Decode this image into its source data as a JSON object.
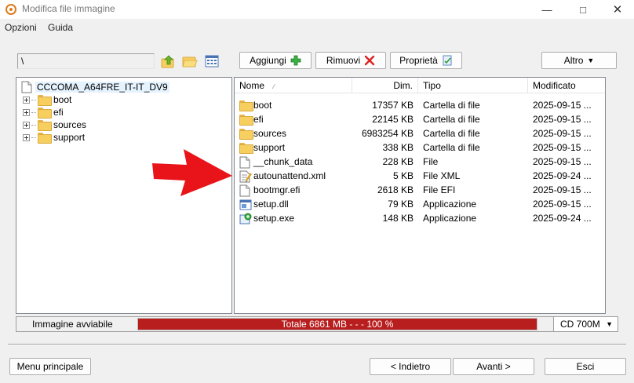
{
  "window": {
    "title": "Modifica file immagine"
  },
  "menu": {
    "items": [
      "Opzioni",
      "Guida"
    ]
  },
  "toolbar": {
    "path": "\\",
    "add_label": "Aggiungi",
    "remove_label": "Rimuovi",
    "properties_label": "Proprietà",
    "more_label": "Altro"
  },
  "tree": {
    "root": "CCCOMA_A64FRE_IT-IT_DV9",
    "items": [
      "boot",
      "efi",
      "sources",
      "support"
    ]
  },
  "list": {
    "columns": {
      "name": "Nome",
      "size": "Dim.",
      "type": "Tipo",
      "modified": "Modificato"
    },
    "rows": [
      {
        "name": "boot",
        "size": "17357 KB",
        "type": "Cartella di file",
        "modified": "2025-09-15 ...",
        "icon": "folder-icon"
      },
      {
        "name": "efi",
        "size": "22145 KB",
        "type": "Cartella di file",
        "modified": "2025-09-15 ...",
        "icon": "folder-icon"
      },
      {
        "name": "sources",
        "size": "6983254 KB",
        "type": "Cartella di file",
        "modified": "2025-09-15 ...",
        "icon": "folder-icon"
      },
      {
        "name": "support",
        "size": "338 KB",
        "type": "Cartella di file",
        "modified": "2025-09-15 ...",
        "icon": "folder-icon"
      },
      {
        "name": "__chunk_data",
        "size": "228 KB",
        "type": "File",
        "modified": "2025-09-15 ...",
        "icon": "file-icon"
      },
      {
        "name": "autounattend.xml",
        "size": "5 KB",
        "type": "File XML",
        "modified": "2025-09-24 ...",
        "icon": "xml-file-icon"
      },
      {
        "name": "bootmgr.efi",
        "size": "2618 KB",
        "type": "File EFI",
        "modified": "2025-09-15 ...",
        "icon": "file-icon"
      },
      {
        "name": "setup.dll",
        "size": "79 KB",
        "type": "Applicazione",
        "modified": "2025-09-15 ...",
        "icon": "dll-icon"
      },
      {
        "name": "setup.exe",
        "size": "148 KB",
        "type": "Applicazione",
        "modified": "2025-09-24 ...",
        "icon": "exe-icon"
      }
    ]
  },
  "status": {
    "boot_label": "Immagine avviabile",
    "progress_text": "Totale 6861 MB  - - -  100 %",
    "progress_fraction": 1.0,
    "media": "CD 700M"
  },
  "footer": {
    "main_menu": "Menu principale",
    "back": "< Indietro",
    "next": "Avanti >",
    "exit": "Esci"
  },
  "colors": {
    "progress": "#b81e1e",
    "arrow": "#e8141a",
    "selection": "#e5f3ff"
  }
}
